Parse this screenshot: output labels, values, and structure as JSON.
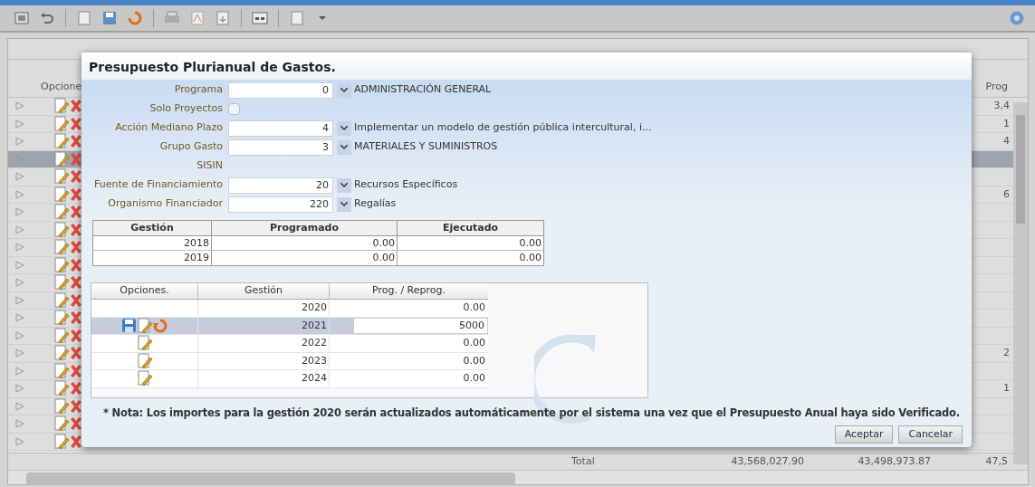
{
  "grid": {
    "columns": {
      "column_1": "Opcione",
      "column_last": "Prog"
    },
    "rows": [
      {
        "selected": false,
        "prog": "3,4"
      },
      {
        "selected": false,
        "prog": "1"
      },
      {
        "selected": false,
        "prog": "4"
      },
      {
        "selected": true
      },
      {
        "selected": false
      },
      {
        "selected": false,
        "prog": "6"
      },
      {
        "selected": false
      },
      {
        "selected": false
      },
      {
        "selected": false
      },
      {
        "selected": false
      },
      {
        "selected": false
      },
      {
        "selected": false
      },
      {
        "selected": false
      },
      {
        "selected": false
      },
      {
        "selected": false,
        "prog": "2"
      },
      {
        "selected": false
      },
      {
        "selected": false,
        "prog": "1"
      },
      {
        "selected": false
      },
      {
        "selected": false
      },
      {
        "selected": false
      }
    ],
    "totals": {
      "label": "Total",
      "column_a": "43,568,027.90",
      "column_b": "43,498,973.87",
      "column_c": "47,5"
    }
  },
  "dialog": {
    "title": "Presupuesto Plurianual de Gastos.",
    "fields": [
      {
        "kind": "select",
        "label": "Programa",
        "code": "0",
        "description": "ADMINISTRACIÓN GENERAL"
      },
      {
        "kind": "checkbox",
        "label": "Solo Proyectos",
        "checked": false
      },
      {
        "kind": "select",
        "label": "Acción Mediano Plazo",
        "code": "4",
        "description": "Implementar un modelo de gestión pública intercultural, i..."
      },
      {
        "kind": "select",
        "label": "Grupo Gasto",
        "code": "3",
        "description": "MATERIALES Y SUMINISTROS"
      },
      {
        "kind": "text",
        "label": "SISIN"
      },
      {
        "kind": "select",
        "label": "Fuente de Financiamiento",
        "code": "20",
        "description": "Recursos Específicos"
      },
      {
        "kind": "select",
        "label": "Organismo Financiador",
        "code": "220",
        "description": "Regalías"
      }
    ],
    "history": {
      "columns": [
        "Gestión",
        "Programado",
        "Ejecutado"
      ],
      "rows": [
        [
          "2018",
          "0.00",
          "0.00"
        ],
        [
          "2019",
          "0.00",
          "0.00"
        ]
      ]
    },
    "plan": {
      "columns": [
        "Opciones.",
        "Gestión",
        "Prog. / Reprog."
      ],
      "rows": [
        {
          "kind": "none",
          "selected": false,
          "year": "2020",
          "value": "0.00"
        },
        {
          "kind": "editing",
          "selected": true,
          "year": "2021",
          "value": "5000"
        },
        {
          "kind": "edit",
          "selected": false,
          "year": "2022",
          "value": "0.00"
        },
        {
          "kind": "edit",
          "selected": false,
          "year": "2023",
          "value": "0.00"
        },
        {
          "kind": "edit",
          "selected": false,
          "year": "2024",
          "value": "0.00"
        }
      ]
    },
    "note": "* Nota: Los importes para la gestión 2020 serán actualizados automáticamente por el sistema una vez que el Presupuesto Anual haya sido Verificado.",
    "buttons": [
      "Aceptar",
      "Cancelar"
    ]
  }
}
